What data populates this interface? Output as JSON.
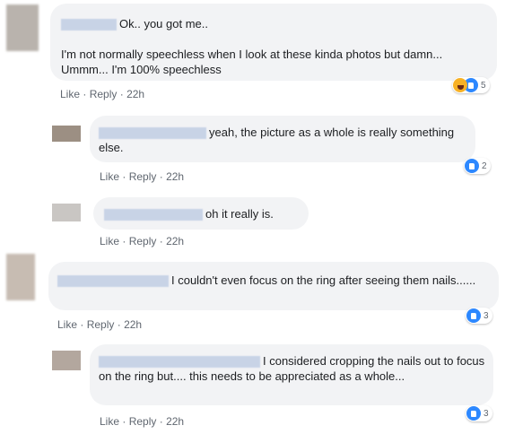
{
  "comments": [
    {
      "text_after_name": "Ok.. you got me..",
      "body": "I'm not normally speechless when I look at these kinda photos but damn... Ummm... I'm 100% speechless",
      "like": "Like",
      "reply": "Reply",
      "sep": "·",
      "time": "22h",
      "reaction_count": "5"
    },
    {
      "text_after_name": "yeah, the picture as a whole is really something else.",
      "like": "Like",
      "reply": "Reply",
      "sep": "·",
      "time": "22h",
      "reaction_count": "2"
    },
    {
      "text_after_name": "oh it really is.",
      "like": "Like",
      "reply": "Reply",
      "sep": "·",
      "time": "22h"
    },
    {
      "text_after_name": "I couldn't even focus on the ring after seeing them nails......",
      "like": "Like",
      "reply": "Reply",
      "sep": "·",
      "time": "22h",
      "reaction_count": "3"
    },
    {
      "text_after_name": "I considered cropping the nails out to focus on the ring but.... this needs to be appreciated as a whole...",
      "like": "Like",
      "reply": "Reply",
      "sep": "·",
      "time": "22h",
      "reaction_count": "3"
    }
  ],
  "colors": {
    "bubble": "#f2f3f5",
    "like_blue": "#2d88ff",
    "meta_gray": "#606770"
  }
}
